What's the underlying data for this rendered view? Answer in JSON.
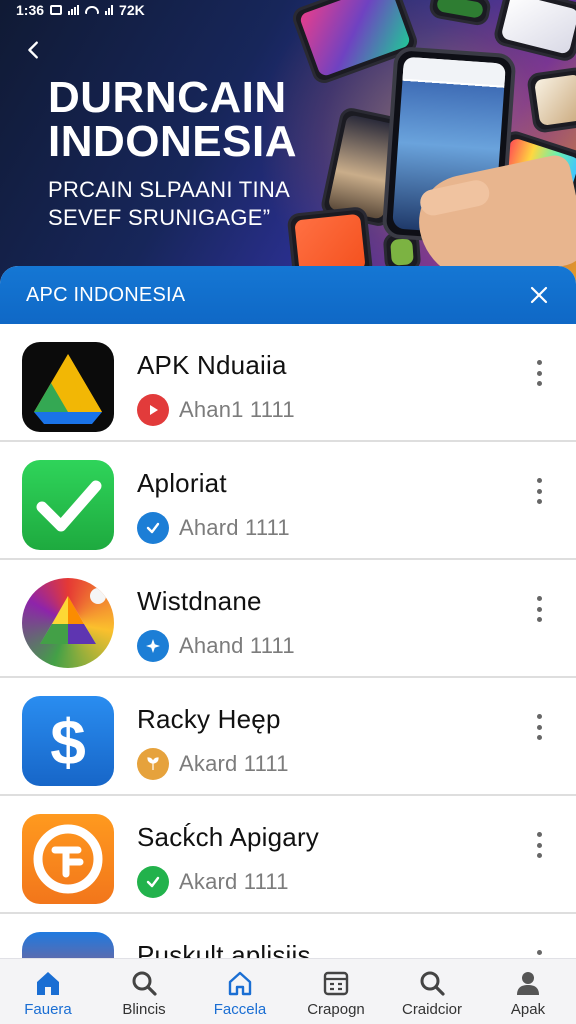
{
  "status_bar": {
    "time": "1:36",
    "network": "72K"
  },
  "hero": {
    "title": "DURNCAIN INDONESIA",
    "subtitle": "PRCAIN SLPAANI TINA SEVEF SRUNIGAGE”"
  },
  "sheet": {
    "title": "APC INDONESIA",
    "apps": [
      {
        "name": "APK Nduaiia",
        "sub": "Ahan1 1111",
        "badge_icon": "play-icon",
        "badge_color": "#e23b3b"
      },
      {
        "name": "Aploriat",
        "sub": "Ahard 1111",
        "badge_icon": "check-icon",
        "badge_color": "#1c7ed6"
      },
      {
        "name": "Wistdnane",
        "sub": "Ahand 1111",
        "badge_icon": "star-icon",
        "badge_color": "#1c7ed6"
      },
      {
        "name": "Racky Heęp",
        "sub": "Akard 1111",
        "badge_icon": "leaf-icon",
        "badge_color": "#e6a23c"
      },
      {
        "name": "Sacḱch Apigary",
        "sub": "Akard 1111",
        "badge_icon": "check-icon",
        "badge_color": "#22b24c"
      },
      {
        "name": "Puskult aplisiis",
        "sub": "",
        "badge_icon": "",
        "badge_color": ""
      }
    ]
  },
  "bottom_nav": [
    {
      "label": "Fauera",
      "icon": "home-icon",
      "active": true
    },
    {
      "label": "Blincis",
      "icon": "search-icon",
      "active": false
    },
    {
      "label": "Faccela",
      "icon": "house-outline-icon",
      "active": true
    },
    {
      "label": "Crapogn",
      "icon": "calendar-icon",
      "active": false
    },
    {
      "label": "Craidcior",
      "icon": "search-icon",
      "active": false
    },
    {
      "label": "Apak",
      "icon": "profile-icon",
      "active": false
    }
  ],
  "colors": {
    "accent": "#1577d4",
    "header_bg": "#0f68c6",
    "text_muted": "#7c7c7c"
  }
}
